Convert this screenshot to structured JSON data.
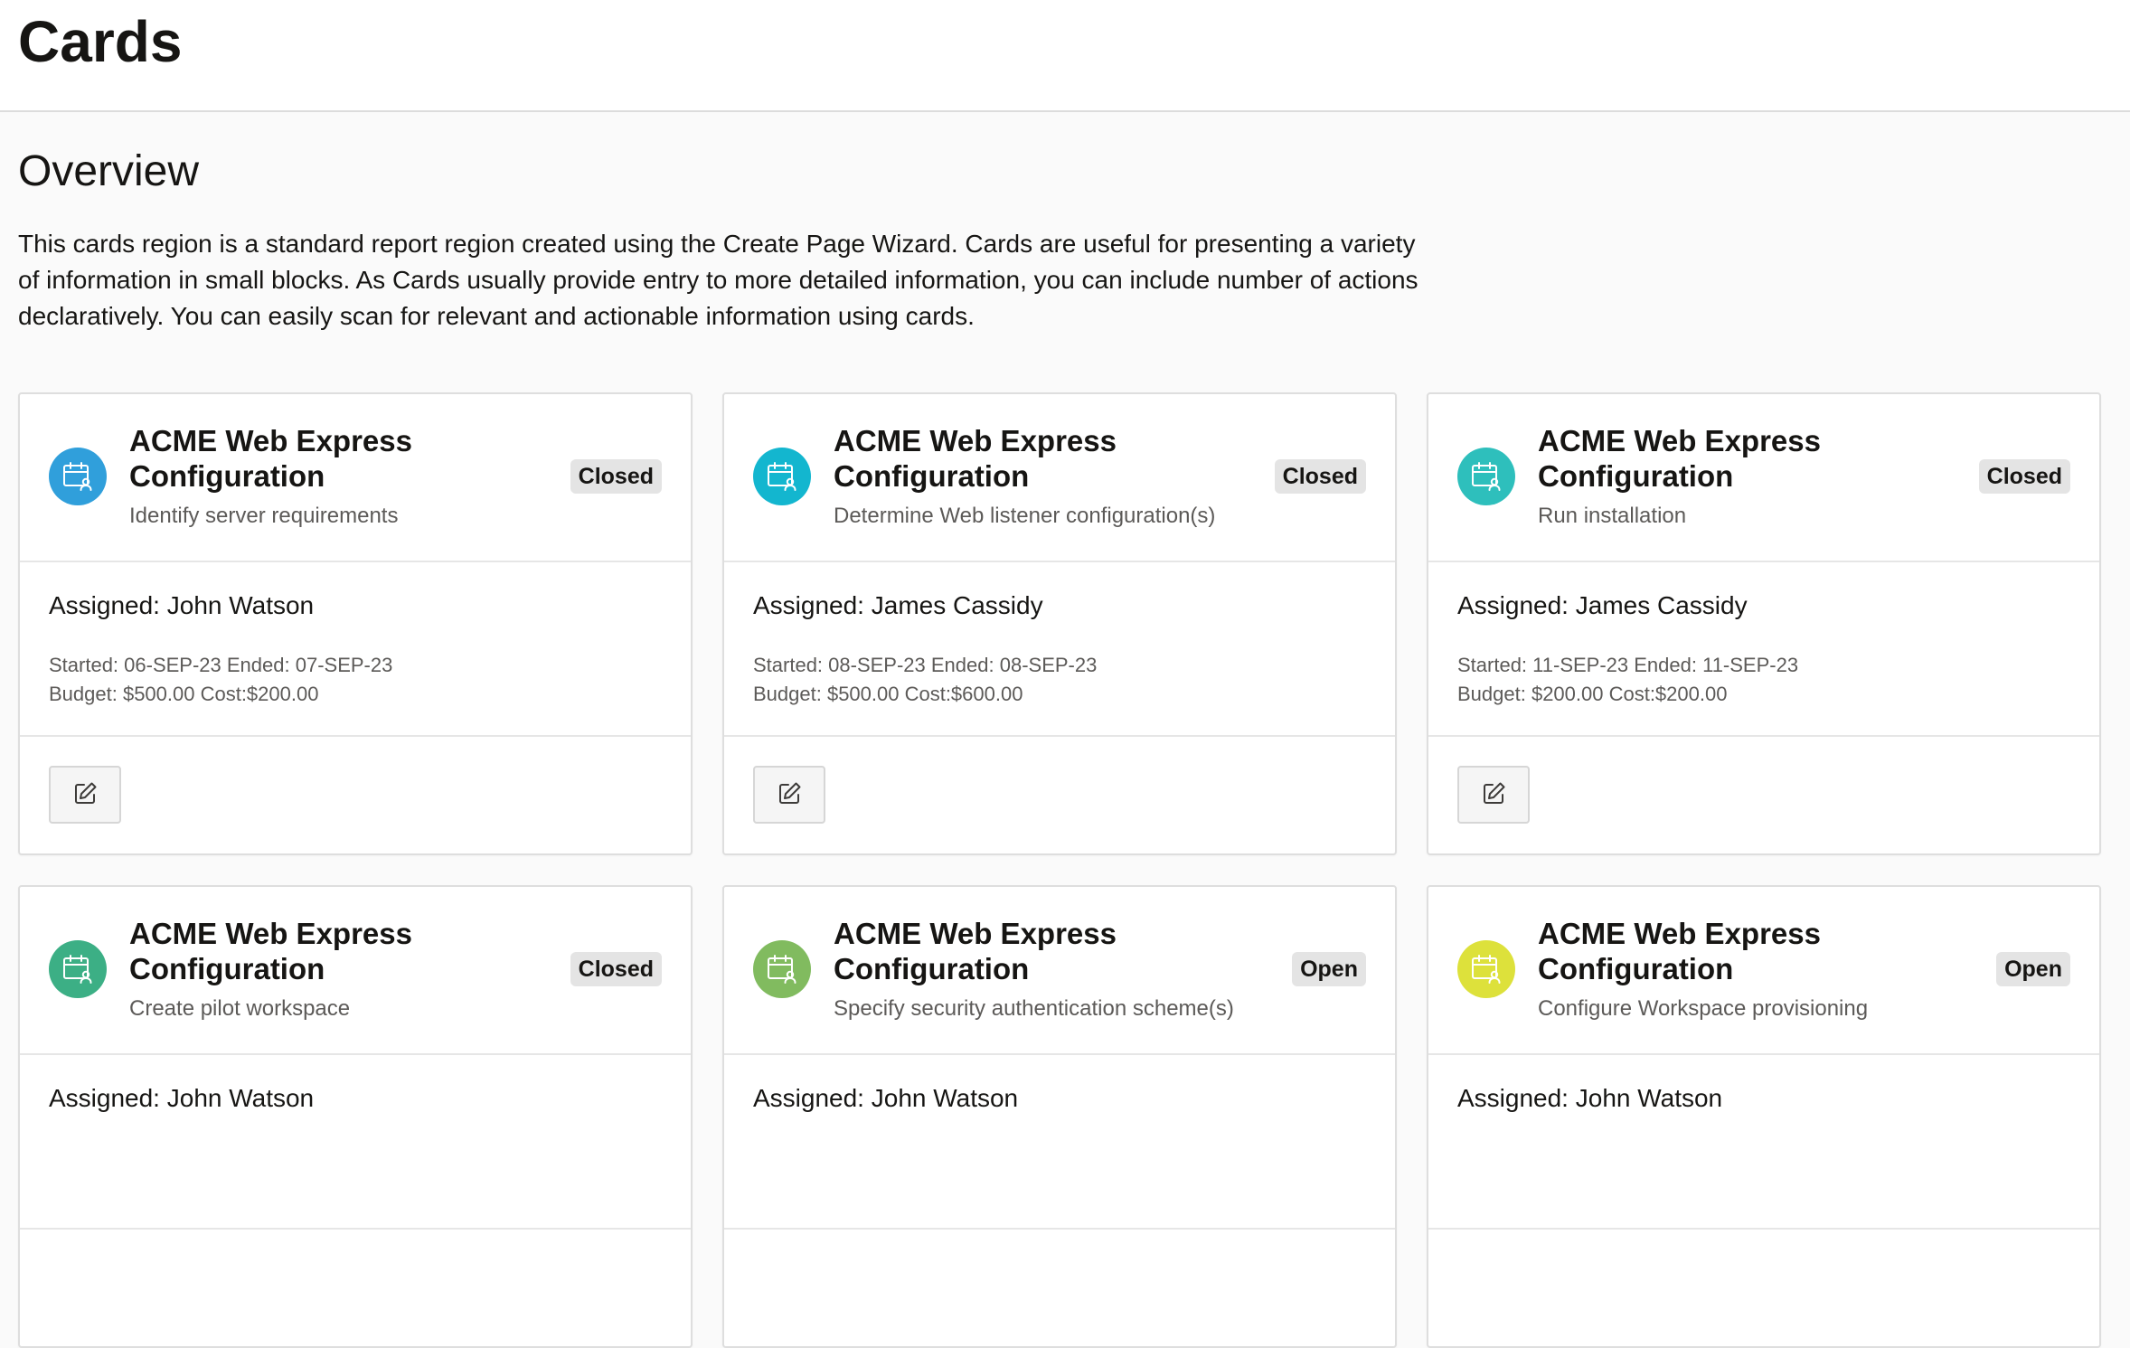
{
  "page": {
    "title": "Cards"
  },
  "overview": {
    "title": "Overview",
    "text": "This cards region is a standard report region created using the Create Page Wizard. Cards are useful for presenting a variety of information in small blocks. As Cards usually provide entry to more detailed information, you can include number of actions declaratively. You can easily scan for relevant and actionable information using cards."
  },
  "cards": [
    {
      "title": "ACME Web Express Configuration",
      "subtitle": "Identify server requirements",
      "status": "Closed",
      "assigned": "Assigned: John Watson",
      "dates": "Started: 06-SEP-23 Ended: 07-SEP-23",
      "budget": "Budget: $500.00 Cost:$200.00",
      "icon": "calendar-user-icon",
      "icon_color": "#309fdb"
    },
    {
      "title": "ACME Web Express Configuration",
      "subtitle": "Determine Web listener configuration(s)",
      "status": "Closed",
      "assigned": "Assigned: James Cassidy",
      "dates": "Started: 08-SEP-23 Ended: 08-SEP-23",
      "budget": "Budget: $500.00 Cost:$600.00",
      "icon": "calendar-user-icon",
      "icon_color": "#13b6cf"
    },
    {
      "title": "ACME Web Express Configuration",
      "subtitle": "Run installation",
      "status": "Closed",
      "assigned": "Assigned: James Cassidy",
      "dates": "Started: 11-SEP-23 Ended: 11-SEP-23",
      "budget": "Budget: $200.00 Cost:$200.00",
      "icon": "calendar-user-icon",
      "icon_color": "#2ebfbc"
    },
    {
      "title": "ACME Web Express Configuration",
      "subtitle": "Create pilot workspace",
      "status": "Closed",
      "assigned": "Assigned: John Watson",
      "icon": "calendar-user-icon",
      "icon_color": "#3caf85"
    },
    {
      "title": "ACME Web Express Configuration",
      "subtitle": "Specify security authentication scheme(s)",
      "status": "Open",
      "assigned": "Assigned: John Watson",
      "icon": "calendar-user-icon",
      "icon_color": "#81bb5f"
    },
    {
      "title": "ACME Web Express Configuration",
      "subtitle": "Configure Workspace provisioning",
      "status": "Open",
      "assigned": "Assigned: John Watson",
      "icon": "calendar-user-icon",
      "icon_color": "#dde13b"
    }
  ]
}
